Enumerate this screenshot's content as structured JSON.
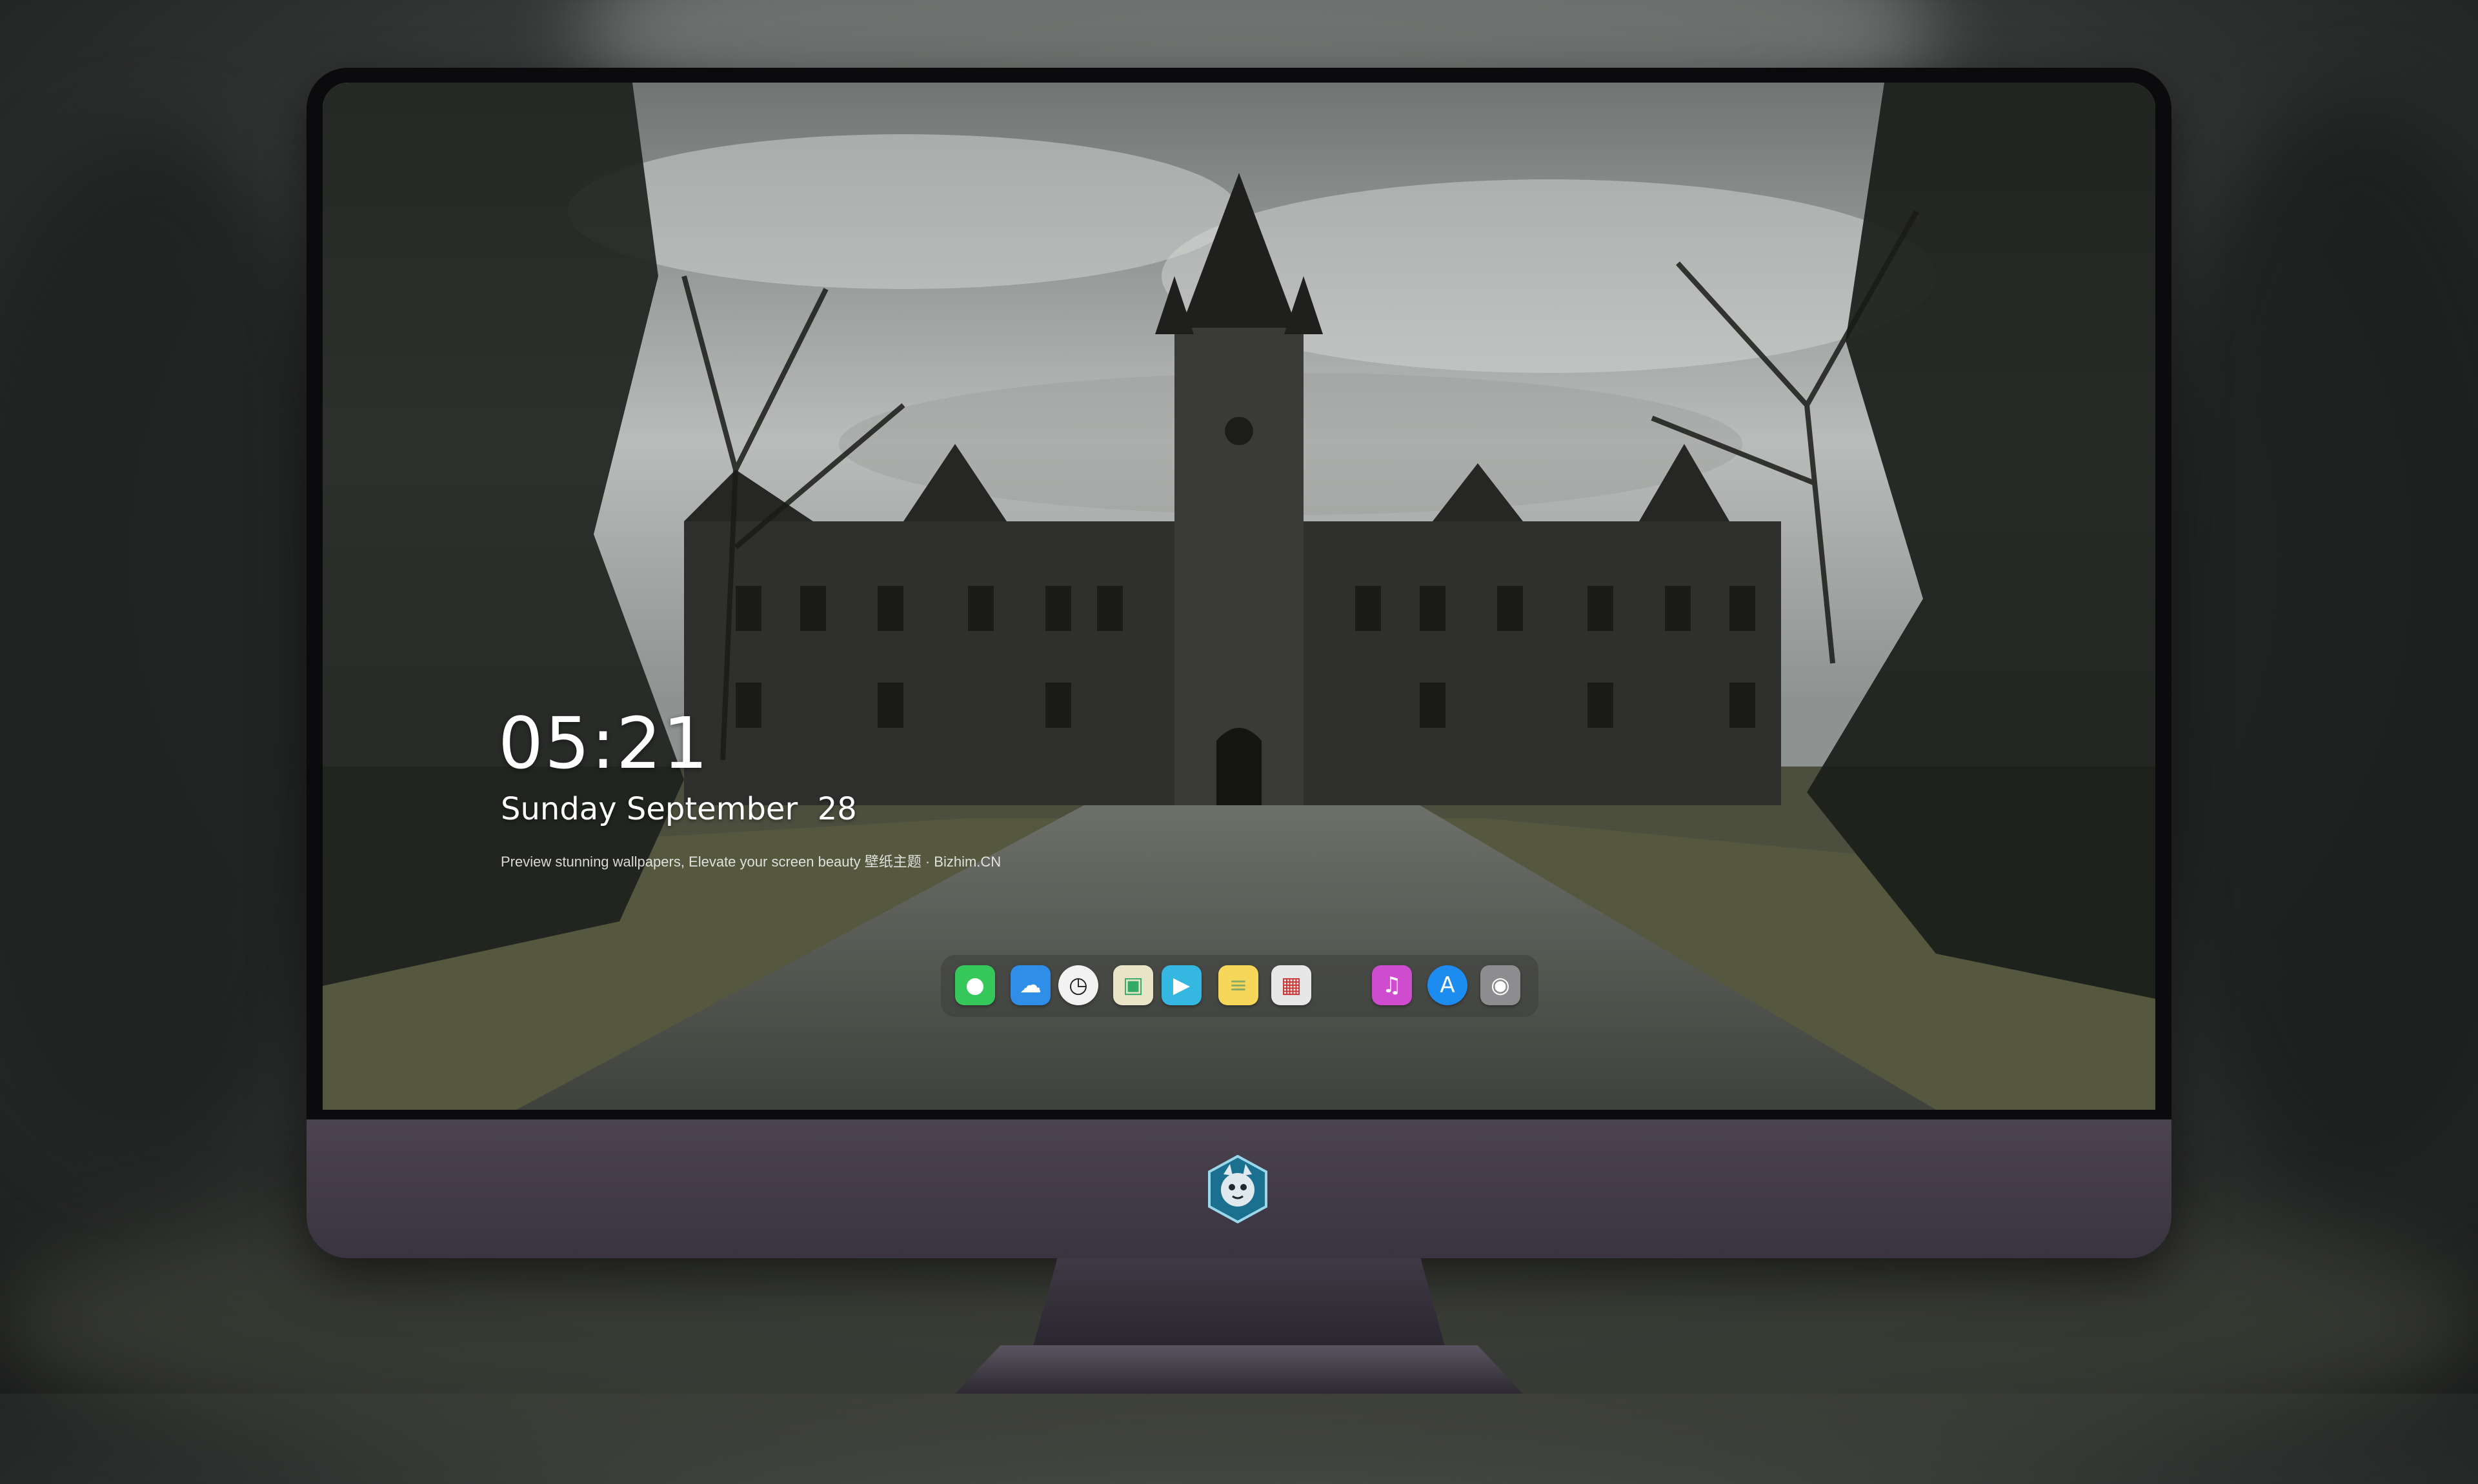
{
  "lockscreen": {
    "time": "05:21",
    "date": "Sunday September  28",
    "tagline": "Preview stunning wallpapers, Elevate your screen beauty  壁纸主题 · Bizhim.CN"
  },
  "dock": {
    "items": [
      {
        "icon": "messages-icon",
        "color": "#35c759"
      },
      {
        "icon": "weather-icon",
        "color": "#2f8fe8"
      },
      {
        "icon": "clock-icon",
        "color": "#f2f2f2"
      },
      {
        "icon": "preview-icon",
        "color": "#e9e3c8"
      },
      {
        "icon": "clips-icon",
        "color": "#34b7e0"
      },
      {
        "icon": "notes-icon",
        "color": "#f6d75a"
      },
      {
        "icon": "photo-booth-icon",
        "color": "#e7e7e7"
      },
      {
        "icon": "itunes-icon",
        "color": "#d04ccf"
      },
      {
        "icon": "app-store-icon",
        "color": "#1d8cf0"
      },
      {
        "icon": "camera-icon",
        "color": "#8d8d8f"
      }
    ]
  },
  "colors": {
    "monitor_frame": "#0b0a0c",
    "monitor_chin": "#4b4450",
    "clock_text": "#ffffff"
  }
}
